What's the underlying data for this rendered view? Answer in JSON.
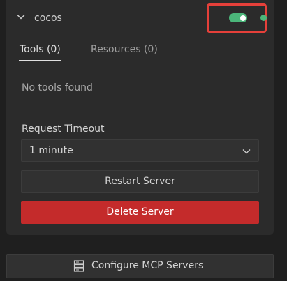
{
  "server": {
    "name": "cocos",
    "enabled": true,
    "status": "running"
  },
  "tabs": [
    {
      "label": "Tools (0)",
      "active": true
    },
    {
      "label": "Resources (0)",
      "active": false
    }
  ],
  "tools": {
    "empty_message": "No tools found"
  },
  "timeout": {
    "label": "Request Timeout",
    "selected": "1 minute"
  },
  "actions": {
    "restart_label": "Restart Server",
    "delete_label": "Delete Server"
  },
  "footer": {
    "configure_label": "Configure MCP Servers"
  },
  "colors": {
    "accent_green": "#4bb67a",
    "danger_red": "#c42b2b",
    "highlight_red": "#e5403a"
  }
}
